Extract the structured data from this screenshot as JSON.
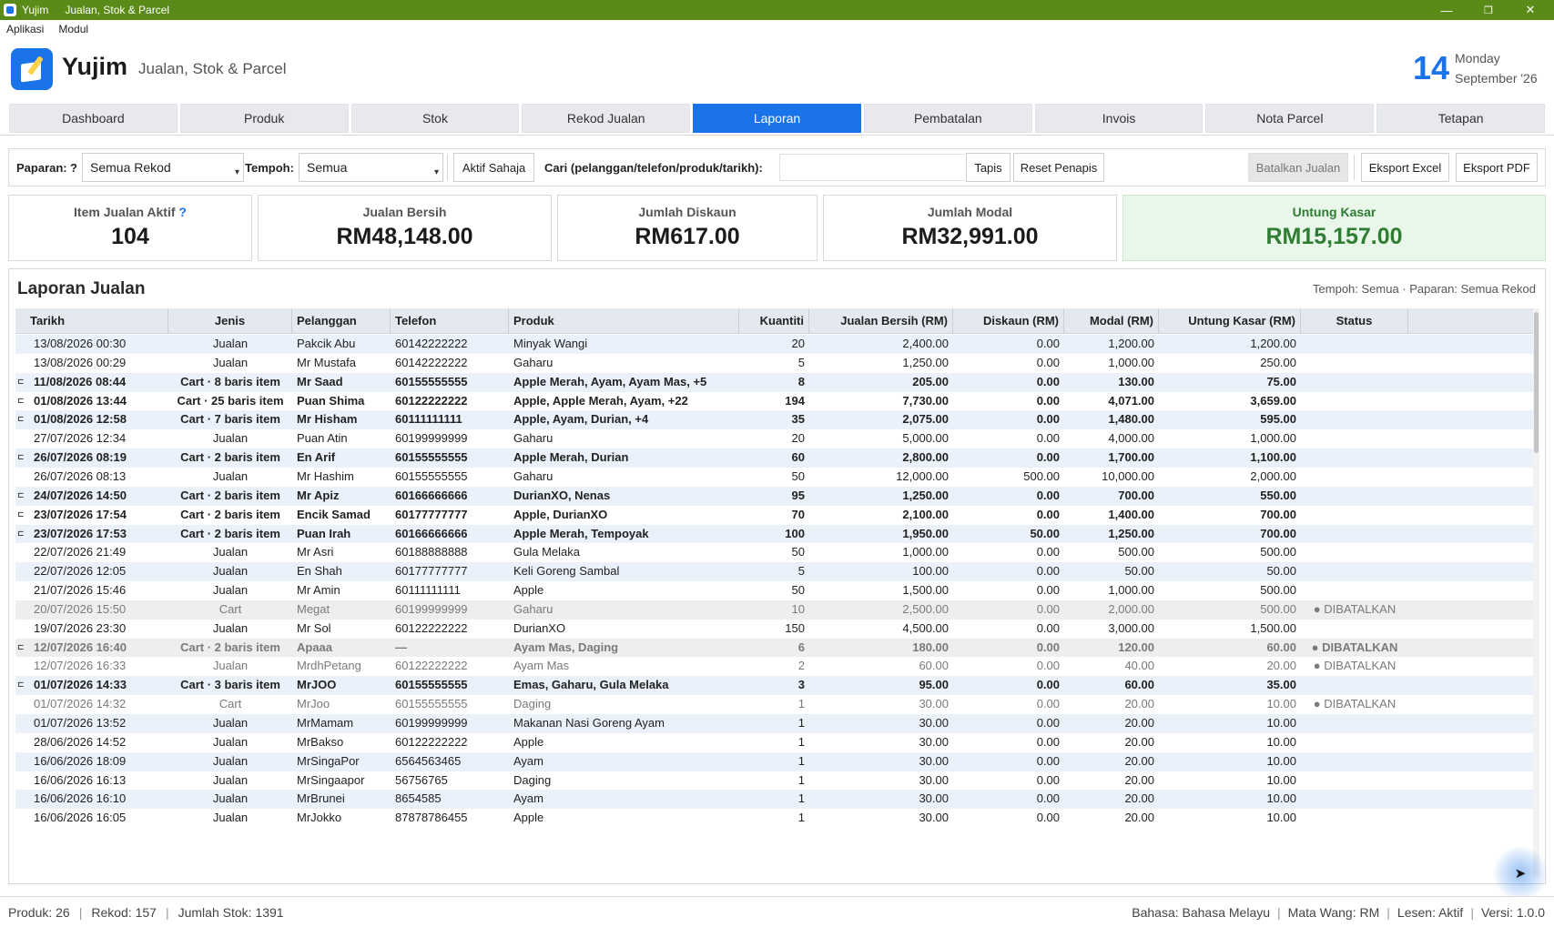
{
  "titlebar": {
    "app": "Yujim",
    "subtitle": "Jualan, Stok & Parcel",
    "min": "—",
    "restore": "❐",
    "close": "✕"
  },
  "menu": [
    "Aplikasi",
    "Modul"
  ],
  "header": {
    "brand": "Yujim",
    "tagline": "Jualan, Stok & Parcel",
    "day": "14",
    "weekday": "Monday",
    "month_year": "September '26"
  },
  "tabs": [
    "Dashboard",
    "Produk",
    "Stok",
    "Rekod Jualan",
    "Laporan",
    "Pembatalan",
    "Invois",
    "Nota Parcel",
    "Tetapan"
  ],
  "active_tab": "Laporan",
  "toolbar": {
    "paparan_label": "Paparan:",
    "help": "?",
    "paparan_value": "Semua Rekod",
    "tempoh_label": "Tempoh:",
    "tempoh_value": "Semua",
    "aktif_btn": "Aktif Sahaja",
    "search_label": "Cari (pelanggan/telefon/produk/tarikh):",
    "search_value": "",
    "tapis_btn": "Tapis",
    "reset_btn": "Reset Penapis",
    "batal_btn": "Batalkan Jualan",
    "excel_btn": "Eksport Excel",
    "pdf_btn": "Eksport PDF"
  },
  "cards": [
    {
      "title": "Item Jualan Aktif",
      "value": "104"
    },
    {
      "title": "Jualan Bersih",
      "value": "RM48,148.00"
    },
    {
      "title": "Jumlah Diskaun",
      "value": "RM617.00"
    },
    {
      "title": "Jumlah Modal",
      "value": "RM32,991.00"
    },
    {
      "title": "Untung Kasar",
      "value": "RM15,157.00"
    }
  ],
  "report": {
    "title": "Laporan Jualan",
    "meta": "Tempoh: Semua · Paparan: Semua Rekod",
    "columns": [
      "Tarikh",
      "Jenis",
      "Pelanggan",
      "Telefon",
      "Produk",
      "Kuantiti",
      "Jualan Bersih (RM)",
      "Diskaun (RM)",
      "Modal (RM)",
      "Untung Kasar (RM)",
      "Status"
    ],
    "rows": [
      [
        "13/08/2026 00:30",
        "Jualan",
        "Pakcik Abu",
        "60142222222",
        "Minyak Wangi",
        "20",
        "2,400.00",
        "0.00",
        "1,200.00",
        "1,200.00",
        ""
      ],
      [
        "13/08/2026 00:29",
        "Jualan",
        "Mr Mustafa",
        "60142222222",
        "Gaharu",
        "5",
        "1,250.00",
        "0.00",
        "1,000.00",
        "250.00",
        ""
      ],
      [
        "11/08/2026 08:44",
        "Cart · 8 baris item",
        "Mr Saad",
        "60155555555",
        "Apple Merah, Ayam, Ayam Mas, +5",
        "8",
        "205.00",
        "0.00",
        "130.00",
        "75.00",
        ""
      ],
      [
        "01/08/2026 13:44",
        "Cart · 25 baris item",
        "Puan Shima",
        "60122222222",
        "Apple, Apple Merah, Ayam, +22",
        "194",
        "7,730.00",
        "0.00",
        "4,071.00",
        "3,659.00",
        ""
      ],
      [
        "01/08/2026 12:58",
        "Cart · 7 baris item",
        "Mr Hisham",
        "60111111111",
        "Apple, Ayam, Durian, +4",
        "35",
        "2,075.00",
        "0.00",
        "1,480.00",
        "595.00",
        ""
      ],
      [
        "27/07/2026 12:34",
        "Jualan",
        "Puan Atin",
        "60199999999",
        "Gaharu",
        "20",
        "5,000.00",
        "0.00",
        "4,000.00",
        "1,000.00",
        ""
      ],
      [
        "26/07/2026 08:19",
        "Cart · 2 baris item",
        "En Arif",
        "60155555555",
        "Apple Merah, Durian",
        "60",
        "2,800.00",
        "0.00",
        "1,700.00",
        "1,100.00",
        ""
      ],
      [
        "26/07/2026 08:13",
        "Jualan",
        "Mr Hashim",
        "60155555555",
        "Gaharu",
        "50",
        "12,000.00",
        "500.00",
        "10,000.00",
        "2,000.00",
        ""
      ],
      [
        "24/07/2026 14:50",
        "Cart · 2 baris item",
        "Mr Apiz",
        "60166666666",
        "DurianXO, Nenas",
        "95",
        "1,250.00",
        "0.00",
        "700.00",
        "550.00",
        ""
      ],
      [
        "23/07/2026 17:54",
        "Cart · 2 baris item",
        "Encik Samad",
        "60177777777",
        "Apple, DurianXO",
        "70",
        "2,100.00",
        "0.00",
        "1,400.00",
        "700.00",
        ""
      ],
      [
        "23/07/2026 17:53",
        "Cart · 2 baris item",
        "Puan Irah",
        "60166666666",
        "Apple Merah, Tempoyak",
        "100",
        "1,950.00",
        "50.00",
        "1,250.00",
        "700.00",
        ""
      ],
      [
        "22/07/2026 21:49",
        "Jualan",
        "Mr Asri",
        "60188888888",
        "Gula Melaka",
        "50",
        "1,000.00",
        "0.00",
        "500.00",
        "500.00",
        ""
      ],
      [
        "22/07/2026 12:05",
        "Jualan",
        "En Shah",
        "60177777777",
        "Keli Goreng Sambal",
        "5",
        "100.00",
        "0.00",
        "50.00",
        "50.00",
        ""
      ],
      [
        "21/07/2026 15:46",
        "Jualan",
        "Mr Amin",
        "60111111111",
        "Apple",
        "50",
        "1,500.00",
        "0.00",
        "1,000.00",
        "500.00",
        ""
      ],
      [
        "20/07/2026 15:50",
        "Cart",
        "Megat",
        "60199999999",
        "Gaharu",
        "10",
        "2,500.00",
        "0.00",
        "2,000.00",
        "500.00",
        "● DIBATALKAN"
      ],
      [
        "19/07/2026 23:30",
        "Jualan",
        "Mr Sol",
        "60122222222",
        "DurianXO",
        "150",
        "4,500.00",
        "0.00",
        "3,000.00",
        "1,500.00",
        ""
      ],
      [
        "12/07/2026 16:40",
        "Cart · 2 baris item",
        "Apaaa",
        "—",
        "Ayam Mas, Daging",
        "6",
        "180.00",
        "0.00",
        "120.00",
        "60.00",
        "● DIBATALKAN"
      ],
      [
        "12/07/2026 16:33",
        "Jualan",
        "MrdhPetang",
        "60122222222",
        "Ayam Mas",
        "2",
        "60.00",
        "0.00",
        "40.00",
        "20.00",
        "● DIBATALKAN"
      ],
      [
        "01/07/2026 14:33",
        "Cart · 3 baris item",
        "MrJOO",
        "60155555555",
        "Emas, Gaharu, Gula Melaka",
        "3",
        "95.00",
        "0.00",
        "60.00",
        "35.00",
        ""
      ],
      [
        "01/07/2026 14:32",
        "Cart",
        "MrJoo",
        "60155555555",
        "Daging",
        "1",
        "30.00",
        "0.00",
        "20.00",
        "10.00",
        "● DIBATALKAN"
      ],
      [
        "01/07/2026 13:52",
        "Jualan",
        "MrMamam",
        "60199999999",
        "Makanan Nasi Goreng Ayam",
        "1",
        "30.00",
        "0.00",
        "20.00",
        "10.00",
        ""
      ],
      [
        "28/06/2026 14:52",
        "Jualan",
        "MrBakso",
        "60122222222",
        "Apple",
        "1",
        "30.00",
        "0.00",
        "20.00",
        "10.00",
        ""
      ],
      [
        "16/06/2026 18:09",
        "Jualan",
        "MrSingaPor",
        "6564563465",
        "Ayam",
        "1",
        "30.00",
        "0.00",
        "20.00",
        "10.00",
        ""
      ],
      [
        "16/06/2026 16:13",
        "Jualan",
        "MrSingaapor",
        "56756765",
        "Daging",
        "1",
        "30.00",
        "0.00",
        "20.00",
        "10.00",
        ""
      ],
      [
        "16/06/2026 16:10",
        "Jualan",
        "MrBrunei",
        "8654585",
        "Ayam",
        "1",
        "30.00",
        "0.00",
        "20.00",
        "10.00",
        ""
      ],
      [
        "16/06/2026 16:05",
        "Jualan",
        "MrJokko",
        "87878786455",
        "Apple",
        "1",
        "30.00",
        "0.00",
        "20.00",
        "10.00",
        ""
      ]
    ]
  },
  "statusbar": {
    "produk": "Produk: 26",
    "rekod": "Rekod: 157",
    "stok": "Jumlah Stok: 1391",
    "bahasa": "Bahasa: Bahasa Melayu",
    "wang": "Mata Wang: RM",
    "lesen": "Lesen: Aktif",
    "versi": "Versi: 1.0.0"
  },
  "fab_icon": "cursor-arrow-icon",
  "colors": {
    "accent": "#1a73e8",
    "titlebar": "#5a8a17",
    "profit": "#2e7d32",
    "row_alt": "#eaf1fb"
  }
}
